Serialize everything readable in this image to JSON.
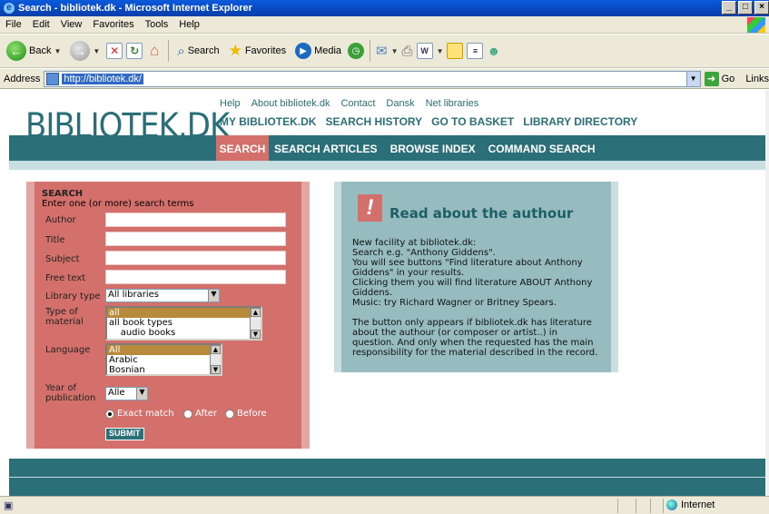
{
  "window": {
    "title": "Search - bibliotek.dk - Microsoft Internet Explorer",
    "buttons": [
      "_",
      "□",
      "×"
    ]
  },
  "menu": [
    "File",
    "Edit",
    "View",
    "Favorites",
    "Tools",
    "Help"
  ],
  "toolbar": {
    "back": "Back",
    "search": "Search",
    "favorites": "Favorites",
    "media": "Media"
  },
  "address": {
    "label": "Address",
    "url": "http://bibliotek.dk/",
    "go": "Go",
    "links": "Links"
  },
  "site": {
    "logo": "BIBLIOTEK.DK",
    "top_links": [
      "Help",
      "About bibliotek.dk",
      "Contact",
      "Dansk",
      "Net libraries"
    ],
    "main_links": [
      "MY BIBLIOTEK.DK",
      "SEARCH HISTORY",
      "GO TO BASKET",
      "LIBRARY DIRECTORY"
    ],
    "tabs": {
      "active": "SEARCH",
      "others": [
        "SEARCH ARTICLES",
        "BROWSE INDEX",
        "COMMAND SEARCH"
      ]
    }
  },
  "form": {
    "title": "SEARCH",
    "subtitle": "Enter one (or more) search terms",
    "author": "Author",
    "title_field": "Title",
    "subject": "Subject",
    "free_text": "Free text",
    "library_type": {
      "label": "Library type",
      "value": "All libraries"
    },
    "type_of_material": {
      "label1": "Type of",
      "label2": "material",
      "options": [
        "all",
        "all book types",
        "    audio books"
      ]
    },
    "language": {
      "label": "Language",
      "options": [
        "All",
        "Arabic",
        "Bosnian"
      ]
    },
    "year": {
      "label1": "Year of",
      "label2": "publication",
      "value": "Alle"
    },
    "match": {
      "exact": "Exact match",
      "after": "After",
      "before": "Before",
      "selected": "exact"
    },
    "submit": "SUBMIT"
  },
  "info": {
    "badge": "!",
    "title": "Read about the authour",
    "para1": "New facility at bibliotek.dk:\nSearch e.g. \"Anthony Giddens\".\nYou will see buttons \"Find literature about Anthony\nGiddens\" in your results.\nClicking them you will find literature ABOUT Anthony\nGiddens.\nMusic: try Richard Wagner or Britney Spears.",
    "para2": "The button only appears if bibliotek.dk has literature\nabout the authour (or composer or artist..) in\nquestion. And only when the requested has the main\nresponsibility for the material described in the record."
  },
  "status": {
    "zone": "Internet"
  },
  "colors": {
    "teal": "#2b7079",
    "salmon": "#d4706b",
    "info_bg": "#96bcc0"
  }
}
